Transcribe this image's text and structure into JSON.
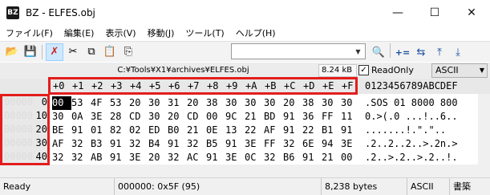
{
  "window": {
    "app_icon_text": "BZ",
    "title": "BZ - ELFES.obj",
    "controls": {
      "minimize": "—",
      "maximize": "☐",
      "close": "✕"
    }
  },
  "menu": [
    {
      "label": "ファイル(F)"
    },
    {
      "label": "編集(E)"
    },
    {
      "label": "表示(V)"
    },
    {
      "label": "移動(J)"
    },
    {
      "label": "ツール(T)"
    },
    {
      "label": "ヘルプ(H)"
    }
  ],
  "toolbar": {
    "icons": [
      {
        "name": "open-folder-icon",
        "glyph": "📂"
      },
      {
        "name": "save-icon",
        "glyph": "💾"
      },
      {
        "name": "undo-icon",
        "glyph": "✗"
      },
      {
        "name": "cut-icon",
        "glyph": "✂"
      },
      {
        "name": "copy-icon",
        "glyph": "⧉"
      },
      {
        "name": "paste-icon",
        "glyph": "📋"
      },
      {
        "name": "paste-special-icon",
        "glyph": "⎘"
      }
    ],
    "right_icons": [
      {
        "name": "binoculars-search-icon",
        "glyph": "🔍"
      },
      {
        "name": "add-compare-icon",
        "glyph": "+="
      },
      {
        "name": "sync-icon",
        "glyph": "⇆"
      },
      {
        "name": "jump-top-icon",
        "glyph": "⤒"
      },
      {
        "name": "jump-bottom-icon",
        "glyph": "⤓"
      }
    ],
    "search_value": ""
  },
  "pathbar": {
    "path": "C:¥Tools¥X1¥archives¥ELFES.obj",
    "size": "8.24 kB",
    "readonly_label": "ReadOnly",
    "readonly_checked": true,
    "encoding": "ASCII"
  },
  "hex": {
    "column_headers": [
      "+0",
      "+1",
      "+2",
      "+3",
      "+4",
      "+5",
      "+6",
      "+7",
      "+8",
      "+9",
      "+A",
      "+B",
      "+C",
      "+D",
      "+E",
      "+F"
    ],
    "ascii_header": "0123456789ABCDEF",
    "offsets": [
      {
        "ghost": "00000",
        "label": "0"
      },
      {
        "ghost": "00000",
        "label": "10"
      },
      {
        "ghost": "00000",
        "label": "20"
      },
      {
        "ghost": "00000",
        "label": "30"
      },
      {
        "ghost": "00000",
        "label": "40"
      }
    ],
    "rows": [
      [
        "00",
        "53",
        "4F",
        "53",
        "20",
        "30",
        "31",
        "20",
        "38",
        "30",
        "30",
        "30",
        "20",
        "38",
        "30",
        "30"
      ],
      [
        "30",
        "0A",
        "3E",
        "28",
        "CD",
        "30",
        "20",
        "CD",
        "00",
        "9C",
        "21",
        "BD",
        "91",
        "36",
        "FF",
        "11"
      ],
      [
        "BE",
        "91",
        "01",
        "82",
        "02",
        "ED",
        "B0",
        "21",
        "0E",
        "13",
        "22",
        "AF",
        "91",
        "22",
        "B1",
        "91"
      ],
      [
        "AF",
        "32",
        "B3",
        "91",
        "32",
        "B4",
        "91",
        "32",
        "B5",
        "91",
        "3E",
        "FF",
        "32",
        "6E",
        "94",
        "3E"
      ],
      [
        "32",
        "32",
        "AB",
        "91",
        "3E",
        "20",
        "32",
        "AC",
        "91",
        "3E",
        "0C",
        "32",
        "B6",
        "91",
        "21",
        "00"
      ]
    ],
    "ascii_rows": [
      ".SOS 01 8000 800",
      "0.>(.0 ...!..6..",
      ".......!.\".\"..",
      ".2..2..2..>.2n.>",
      ".2..>.2..>.2..!."
    ]
  },
  "status": {
    "ready": "Ready",
    "position": "000000: 0x5F (95)",
    "bytes": "8,238 bytes",
    "encoding": "ASCII",
    "mode": "書築"
  },
  "colors": {
    "highlight_red": "#e31d1d",
    "cursor_bg": "#000000"
  }
}
